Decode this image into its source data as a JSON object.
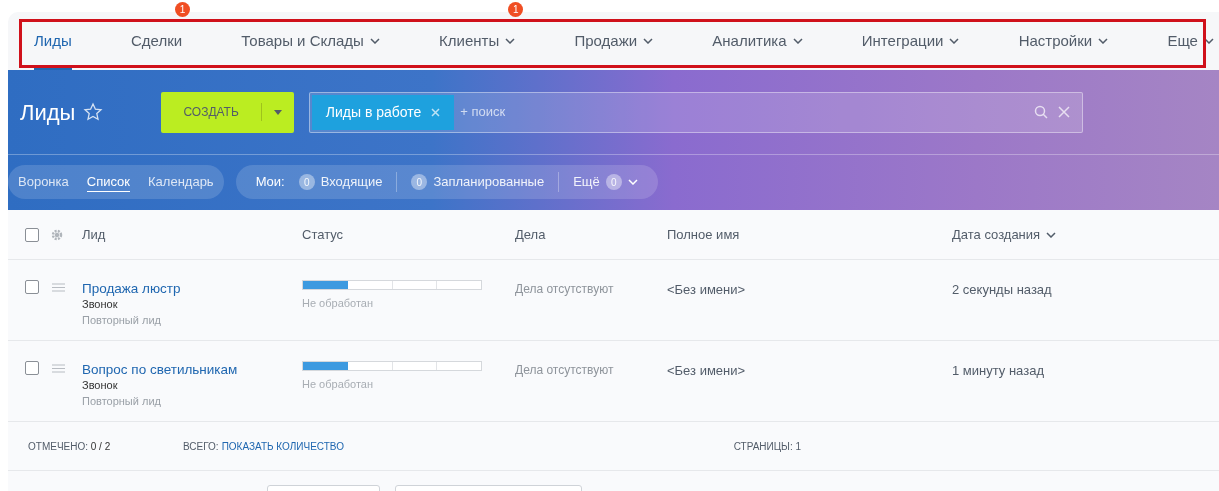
{
  "nav": {
    "items": [
      {
        "label": "Лиды",
        "selected": true,
        "dropdown": false
      },
      {
        "label": "Сделки",
        "selected": false,
        "dropdown": false,
        "badge": "1"
      },
      {
        "label": "Товары и Склады",
        "selected": false,
        "dropdown": true
      },
      {
        "label": "Клиенты",
        "selected": false,
        "dropdown": true,
        "badge": "1"
      },
      {
        "label": "Продажи",
        "selected": false,
        "dropdown": true
      },
      {
        "label": "Аналитика",
        "selected": false,
        "dropdown": true
      },
      {
        "label": "Интеграции",
        "selected": false,
        "dropdown": true
      },
      {
        "label": "Настройки",
        "selected": false,
        "dropdown": true
      },
      {
        "label": "Еще",
        "selected": false,
        "dropdown": true
      }
    ]
  },
  "header": {
    "title": "Лиды",
    "create_button": "СОЗДАТЬ",
    "filter_chip": "Лиды в работе",
    "search_placeholder": "+ поиск"
  },
  "view_tabs": [
    {
      "label": "Воронка",
      "selected": false
    },
    {
      "label": "Список",
      "selected": true
    },
    {
      "label": "Календарь",
      "selected": false
    }
  ],
  "counters": {
    "label": "Мои:",
    "items": [
      {
        "count": "0",
        "label": "Входящие"
      },
      {
        "count": "0",
        "label": "Запланированные"
      }
    ],
    "more": {
      "label": "Ещё",
      "count": "0"
    }
  },
  "table": {
    "select_all_checked": false,
    "columns": [
      {
        "label": "Лид",
        "sorted": false
      },
      {
        "label": "Статус",
        "sorted": false
      },
      {
        "label": "Дела",
        "sorted": false
      },
      {
        "label": "Полное имя",
        "sorted": false
      },
      {
        "label": "Дата создания",
        "sorted": true
      }
    ],
    "rows": [
      {
        "checked": false,
        "title": "Продажа люстр",
        "source": "Звонок",
        "note": "Повторный лид",
        "status": {
          "level": 0.25,
          "label": "Не обработан"
        },
        "tasks": "Дела отсутствуют",
        "name": "<Без имени>",
        "created": "2 секунды назад"
      },
      {
        "checked": false,
        "title": "Вопрос по светильникам",
        "source": "Звонок",
        "note": "Повторный лид",
        "status": {
          "level": 0.25,
          "label": "Не обработан"
        },
        "tasks": "Дела отсутствуют",
        "name": "<Без имени>",
        "created": "1 минуту назад"
      }
    ]
  },
  "footer": {
    "selected_label": "ОТМЕЧЕНО:",
    "selected_value": "0 / 2",
    "total_label": "ВСЕГО:",
    "total_link": "ПОКАЗАТЬ КОЛИЧЕСТВО",
    "pages": "СТРАНИЦЫ: 1"
  }
}
